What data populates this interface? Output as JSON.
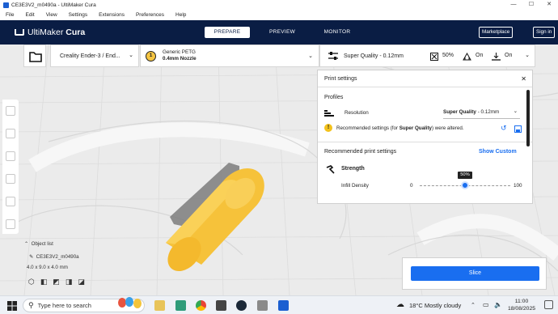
{
  "window": {
    "title": "CE3E3V2_m0490a - UltiMaker Cura",
    "controls": [
      "—",
      "☐",
      "✕"
    ]
  },
  "menu": [
    "File",
    "Edit",
    "View",
    "Settings",
    "Extensions",
    "Preferences",
    "Help"
  ],
  "header": {
    "brand_light": "UltiMaker",
    "brand_bold": "Cura",
    "stages": [
      "PREPARE",
      "PREVIEW",
      "MONITOR"
    ],
    "active_stage": "PREPARE",
    "marketplace": "Marketplace",
    "signin": "Sign in"
  },
  "toolbar": {
    "printer": "Creality Ender-3 / End...",
    "extruder_number": "1",
    "material": "Generic PETG",
    "nozzle": "0.4mm Nozzle",
    "quality": "Super Quality - 0.12mm",
    "infill": "50%",
    "support": "On",
    "adhesion": "On"
  },
  "panel": {
    "title": "Print settings",
    "profiles_label": "Profiles",
    "resolution_label": "Resolution",
    "resolution_value_bold": "Super Quality",
    "resolution_value_rest": " - 0.12mm",
    "warning_pre": "Recommended settings (for ",
    "warning_bold": "Super Quality",
    "warning_post": ") were altered.",
    "recommended_label": "Recommended print settings",
    "show_custom": "Show Custom",
    "strength_label": "Strength",
    "infill_label": "Infill Density",
    "slider_min": "0",
    "slider_max": "100",
    "slider_value": 50,
    "slider_tooltip": "50%"
  },
  "object_list": {
    "header": "Object list",
    "object_name": "CE3E3V2_m0490a",
    "dimensions": "4.0 x 9.0 x 4.0 mm"
  },
  "slice": {
    "label": "Slice"
  },
  "taskbar": {
    "search_placeholder": "Type here to search",
    "weather": "18°C  Mostly cloudy",
    "time": "11:00",
    "date": "18/08/2025"
  },
  "colors": {
    "header": "#0a1d44",
    "accent": "#196ef0",
    "model": "#f7c844"
  }
}
